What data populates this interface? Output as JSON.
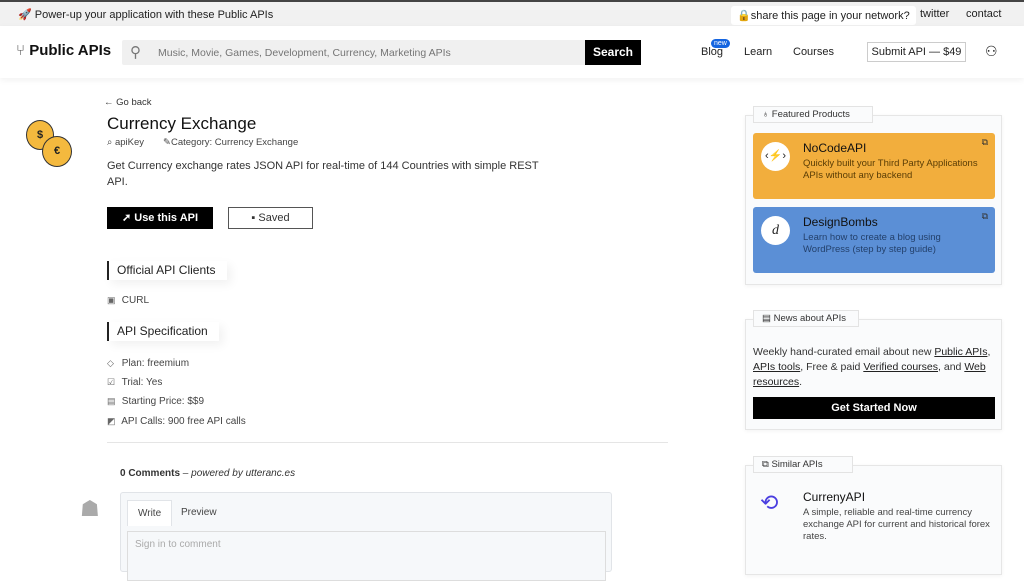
{
  "topbar": {
    "promo": "🚀 Power-up your application with these Public APIs",
    "share": "share this page in your network?",
    "twitter": "twitter",
    "contact": "contact"
  },
  "header": {
    "logo": "Public APIs",
    "search_placeholder": "Music, Movie, Games, Development, Currency, Marketing APIs",
    "search_button": "Search",
    "nav": {
      "blog": "Blog",
      "blog_badge": "new",
      "learn": "Learn",
      "courses": "Courses"
    },
    "submit": "Submit API — $49"
  },
  "api": {
    "go_back": "Go back",
    "title": "Currency Exchange",
    "auth": "apiKey",
    "category": "Category: Currency Exchange",
    "description": "Get Currency exchange rates JSON API for real-time of 144 Countries with simple REST API.",
    "use_button": "Use this API",
    "saved_button": "Saved"
  },
  "clients": {
    "heading": "Official API Clients",
    "items": [
      "CURL"
    ]
  },
  "spec": {
    "heading": "API Specification",
    "plan": "Plan: freemium",
    "trial": "Trial: Yes",
    "price": "Starting Price: $$9",
    "calls": "API Calls: 900 free API calls"
  },
  "comments": {
    "count": "0 Comments",
    "powered": "– powered by utteranc.es",
    "tab_write": "Write",
    "tab_preview": "Preview",
    "placeholder": "Sign in to comment"
  },
  "featured": {
    "title": "Featured Products",
    "products": [
      {
        "name": "NoCodeAPI",
        "desc": "Quickly built your Third Party Applications APIs without any backend",
        "color": "#f2ae3d"
      },
      {
        "name": "DesignBombs",
        "desc": "Learn how to create a blog using WordPress (step by step guide)",
        "color": "#5b8fd6"
      }
    ]
  },
  "news": {
    "title": "News about APIs",
    "text1": "Weekly hand-curated email about new ",
    "link1": "Public APIs",
    "sep1": ", ",
    "link2": "APIs tools",
    "text2": ", Free & paid ",
    "link3": "Verified courses",
    "text3": ", and ",
    "link4": "Web resources",
    "text4": ".",
    "button": "Get Started Now"
  },
  "similar": {
    "title": "Similar APIs",
    "items": [
      {
        "name": "CurrenyAPI",
        "desc": "A simple, reliable and real-time currency exchange API for current and historical forex rates."
      }
    ]
  }
}
